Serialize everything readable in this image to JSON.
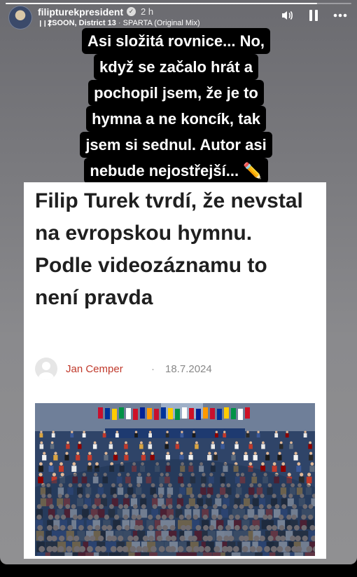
{
  "story": {
    "username": "filipturekpresident",
    "time_ago": "2 h",
    "progress_fraction": 0.9,
    "music": {
      "artist": "2SOON, District 13",
      "separator": "·",
      "track": "SPARTA (Original Mix)"
    },
    "icons": {
      "sound": "speaker-icon",
      "pause": "pause-icon",
      "more": "more-icon",
      "verified": "verified-icon",
      "music": "music-bars-icon"
    }
  },
  "caption": {
    "lines": [
      "Asi složitá rovnice... No,",
      "když se začalo hrát a",
      "pochopil jsem, že je to",
      "hymna a ne koncík, tak",
      "jsem si sednul. Autor asi",
      "nebude nejostřejší... ✏️"
    ]
  },
  "article": {
    "title": "Filip Turek tvrdí, že nevstal na evropskou hymnu. Podle videozáznamu to není pravda",
    "author": "Jan Cemper",
    "separator": "·",
    "date": "18.7.2024"
  },
  "colors": {
    "author_accent": "#c0392b",
    "caption_bg": "#000000",
    "background": "#7a7a7e"
  }
}
